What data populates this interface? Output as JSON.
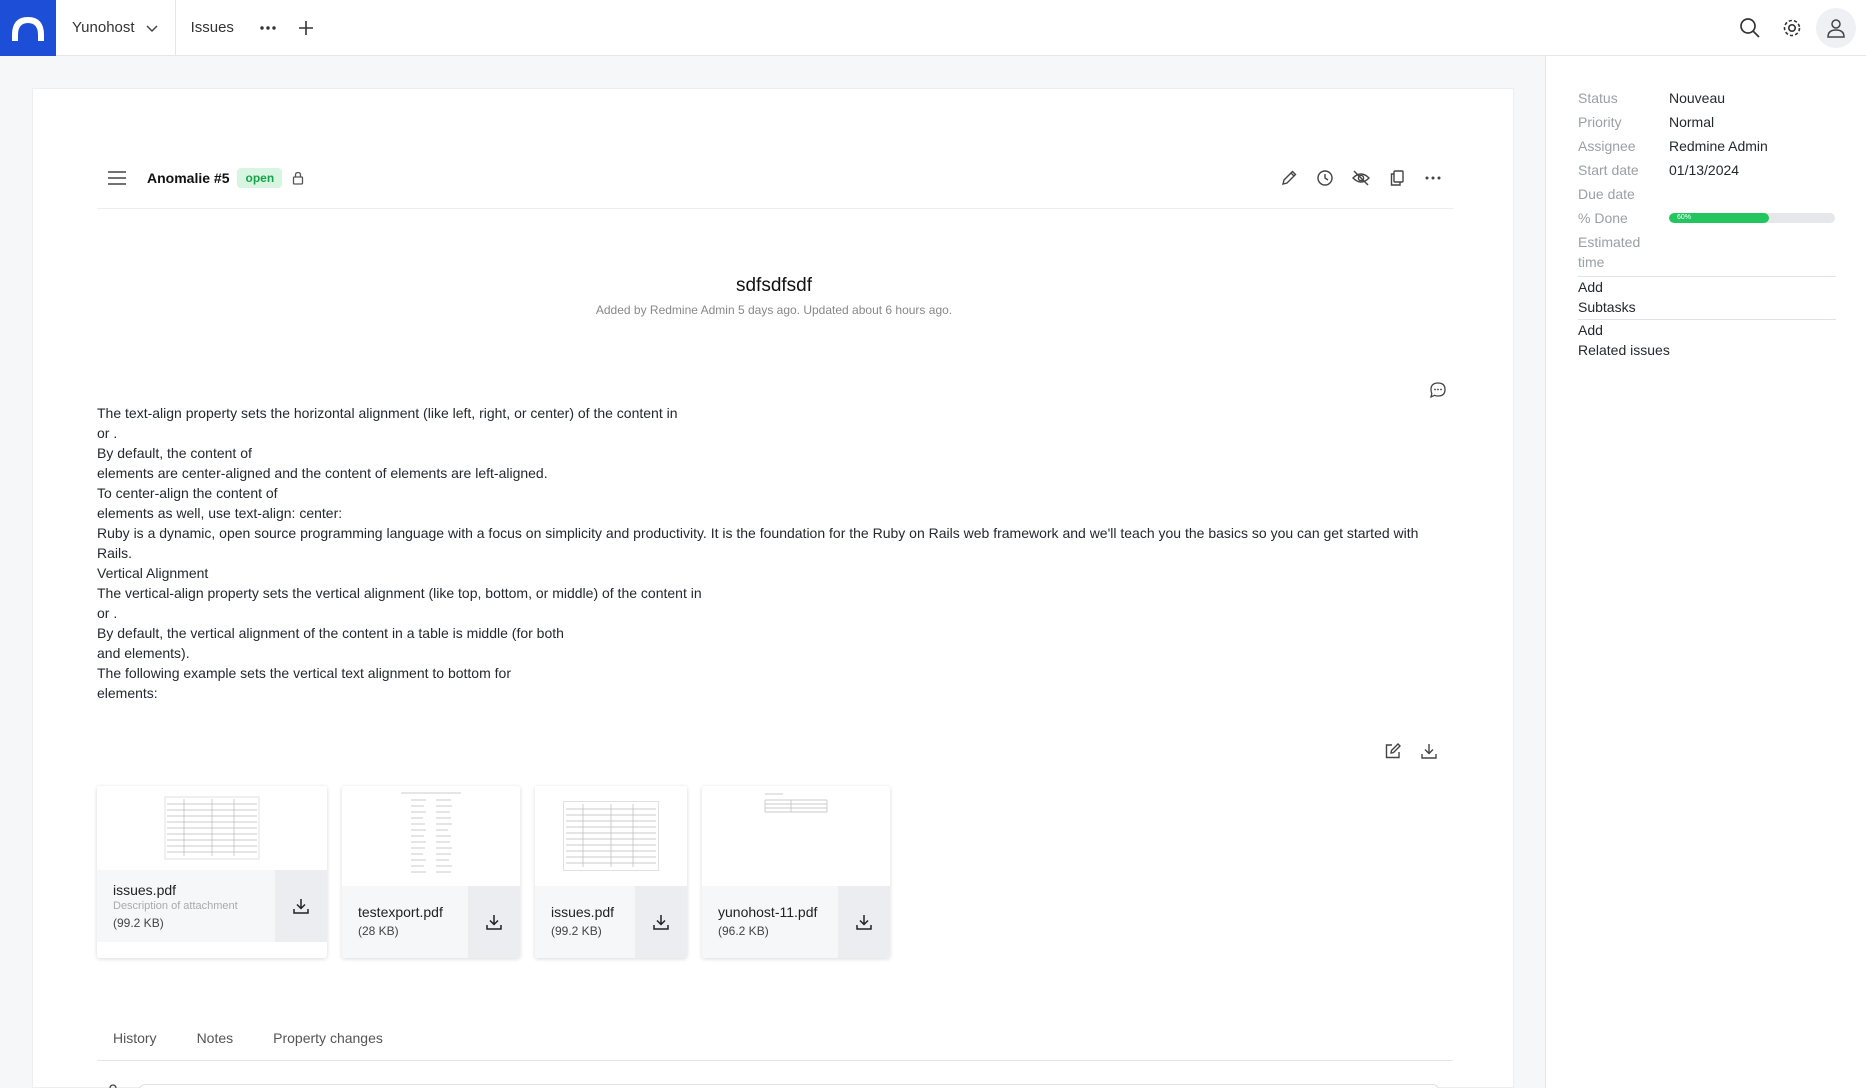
{
  "topbar": {
    "project": "Yunohost",
    "nav_issues": "Issues"
  },
  "issue": {
    "ref": "Anomalie #5",
    "status_badge": "open",
    "title": "sdfsdfsdf",
    "meta": "Added by Redmine Admin 5 days ago. Updated about 6 hours ago.",
    "description": [
      "The text-align property sets the horizontal alignment (like left, right, or center) of the content in",
      "or .",
      "By default, the content of",
      "elements are center-aligned and the content of elements are left-aligned.",
      "To center-align the content of",
      "elements as well, use text-align: center:",
      "Ruby is a dynamic, open source programming language with a focus on simplicity and productivity. It is the foundation for the Ruby on Rails web framework and we'll teach you the basics so you can get started with Rails.",
      "Vertical Alignment",
      "The vertical-align property sets the vertical alignment (like top, bottom, or middle) of the content in",
      "or .",
      "By default, the vertical alignment of the content in a table is middle (for both",
      "and elements).",
      "The following example sets the vertical text alignment to bottom for",
      "elements:"
    ]
  },
  "attachments": [
    {
      "name": "issues.pdf",
      "description": "Description of attachment",
      "size": "(99.2 KB)"
    },
    {
      "name": "testexport.pdf",
      "description": "",
      "size": "(28 KB)"
    },
    {
      "name": "issues.pdf",
      "description": "",
      "size": "(99.2 KB)"
    },
    {
      "name": "yunohost-11.pdf",
      "description": "",
      "size": "(96.2 KB)"
    }
  ],
  "tabs": [
    "History",
    "Notes",
    "Property changes"
  ],
  "sidebar": {
    "status_label": "Status",
    "status_value": "Nouveau",
    "priority_label": "Priority",
    "priority_value": "Normal",
    "assignee_label": "Assignee",
    "assignee_value": "Redmine Admin",
    "start_label": "Start date",
    "start_value": "01/13/2024",
    "due_label": "Due date",
    "due_value": "",
    "done_label": "% Done",
    "done_value": 60,
    "done_text": "60%",
    "estimated_label": "Estimated time",
    "estimated_value": "",
    "subtasks_add": "Add",
    "subtasks_title": "Subtasks",
    "related_add": "Add",
    "related_title": "Related issues"
  },
  "colors": {
    "brand": "#1d4ed8",
    "badge_open_bg": "#d8f5e1",
    "badge_open_text": "#16a34a",
    "progress": "#22c55e"
  }
}
